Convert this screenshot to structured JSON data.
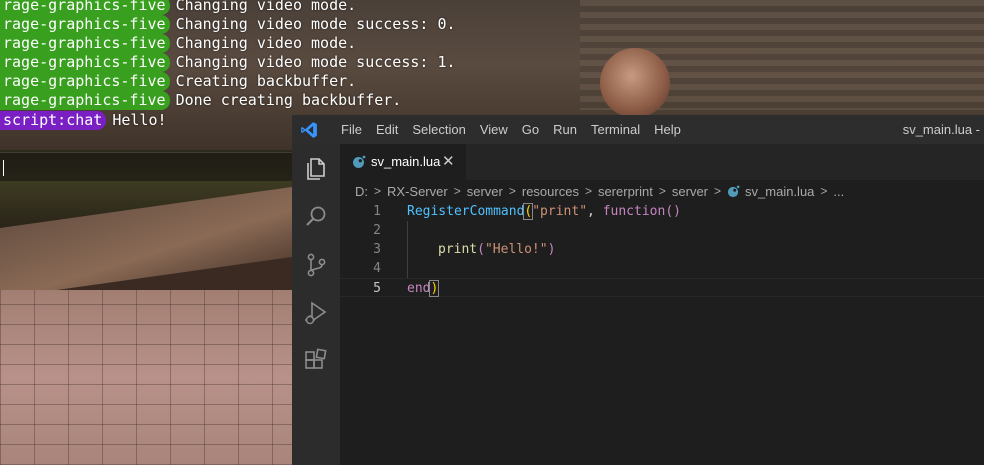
{
  "console": {
    "lines": [
      {
        "tag": "rage-graphics-five",
        "text": "Changing video mode."
      },
      {
        "tag": "rage-graphics-five",
        "text": "Changing video mode success: 0."
      },
      {
        "tag": "rage-graphics-five",
        "text": "Changing video mode."
      },
      {
        "tag": "rage-graphics-five",
        "text": "Changing video mode success: 1."
      },
      {
        "tag": "rage-graphics-five",
        "text": "Creating backbuffer."
      },
      {
        "tag": "rage-graphics-five",
        "text": "Done creating backbuffer."
      },
      {
        "tag": "script:chat",
        "text": "Hello!"
      }
    ],
    "input_value": ""
  },
  "vscode": {
    "menu": [
      "File",
      "Edit",
      "Selection",
      "View",
      "Go",
      "Run",
      "Terminal",
      "Help"
    ],
    "window_title": "sv_main.lua -",
    "tab": {
      "label": "sv_main.lua",
      "close": "✕"
    },
    "breadcrumb": [
      "D:",
      "RX-Server",
      "server",
      "resources",
      "sererprint",
      "server",
      "sv_main.lua",
      "..."
    ],
    "activity_icons": [
      "explorer-icon",
      "search-icon",
      "source-control-icon",
      "run-debug-icon",
      "extensions-icon"
    ],
    "code": {
      "line_numbers": [
        "1",
        "2",
        "3",
        "4",
        "5"
      ],
      "line1": {
        "fn": "RegisterCommand",
        "open": "(",
        "str": "\"print\"",
        "comma": ", ",
        "kw": "function",
        "parens": "()"
      },
      "line3": {
        "fn": "print",
        "open": "(",
        "str": "\"Hello!\"",
        "close": ")"
      },
      "line5": {
        "kw": "end",
        "close": ")"
      }
    },
    "colors": {
      "accent": "#3794ff",
      "editor_bg": "#1e1e1e"
    }
  }
}
